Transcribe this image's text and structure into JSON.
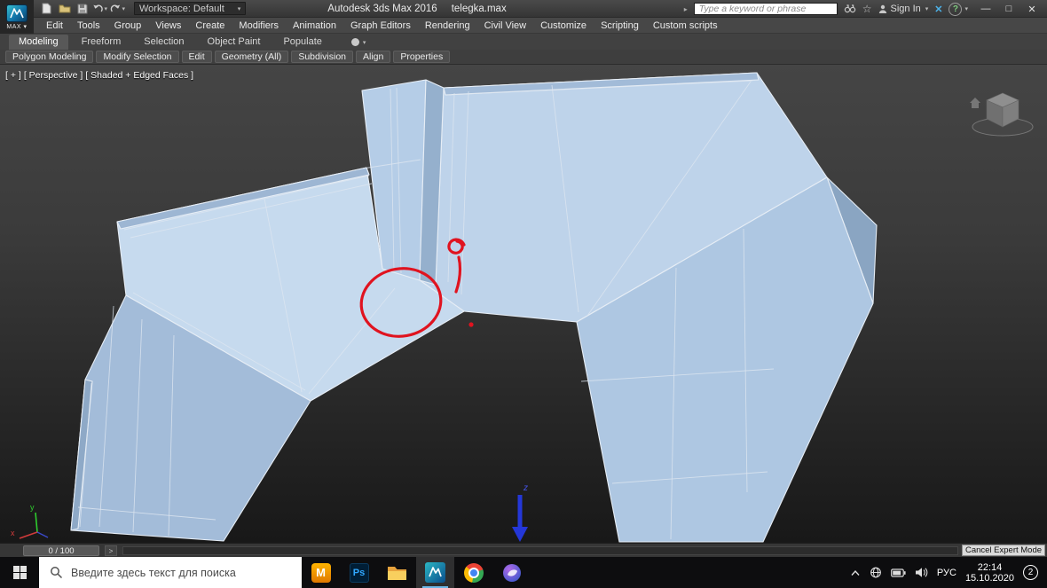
{
  "title_bar": {
    "logo_text": "MAX",
    "workspace": "Workspace: Default",
    "app_title": "Autodesk 3ds Max 2016",
    "document_name": "telegka.max",
    "search_placeholder": "Type a keyword or phrase",
    "sign_in": "Sign In",
    "help_glyph": "?",
    "star_glyph": "☆",
    "community_glyph": "✕",
    "window_controls": {
      "minimize": "—",
      "maximize": "□",
      "close": "✕"
    }
  },
  "menu_bar": {
    "items": [
      "Edit",
      "Tools",
      "Group",
      "Views",
      "Create",
      "Modifiers",
      "Animation",
      "Graph Editors",
      "Rendering",
      "Civil View",
      "Customize",
      "Scripting",
      "Custom scripts"
    ]
  },
  "ribbon": {
    "tabs": [
      "Modeling",
      "Freeform",
      "Selection",
      "Object Paint",
      "Populate"
    ],
    "buttons": [
      "Polygon Modeling",
      "Modify Selection",
      "Edit",
      "Geometry (All)",
      "Subdivision",
      "Align",
      "Properties"
    ]
  },
  "viewport": {
    "overlay": {
      "plus": "[ + ]",
      "view": "[ Perspective ]",
      "shading": "[ Shaded + Edged Faces ]"
    },
    "axis": {
      "x": "x",
      "y": "y",
      "z": "z"
    }
  },
  "timeline": {
    "frame_counter": "0 / 100",
    "next": ">"
  },
  "status_bar": {
    "cancel_expert_mode": "Cancel Expert Mode"
  },
  "taskbar": {
    "search_placeholder": "Введите здесь текст для поиска",
    "mail_icon_label": "M",
    "photoshop_icon_label": "Ps",
    "language": "РУС",
    "time": "22:14",
    "date": "15.10.2020",
    "notification_count": "2"
  },
  "colors": {
    "model_face": "#b9cfe8",
    "model_edge": "#e6edf5",
    "annotation_red": "#e0131f",
    "gizmo_blue": "#2437d8"
  }
}
